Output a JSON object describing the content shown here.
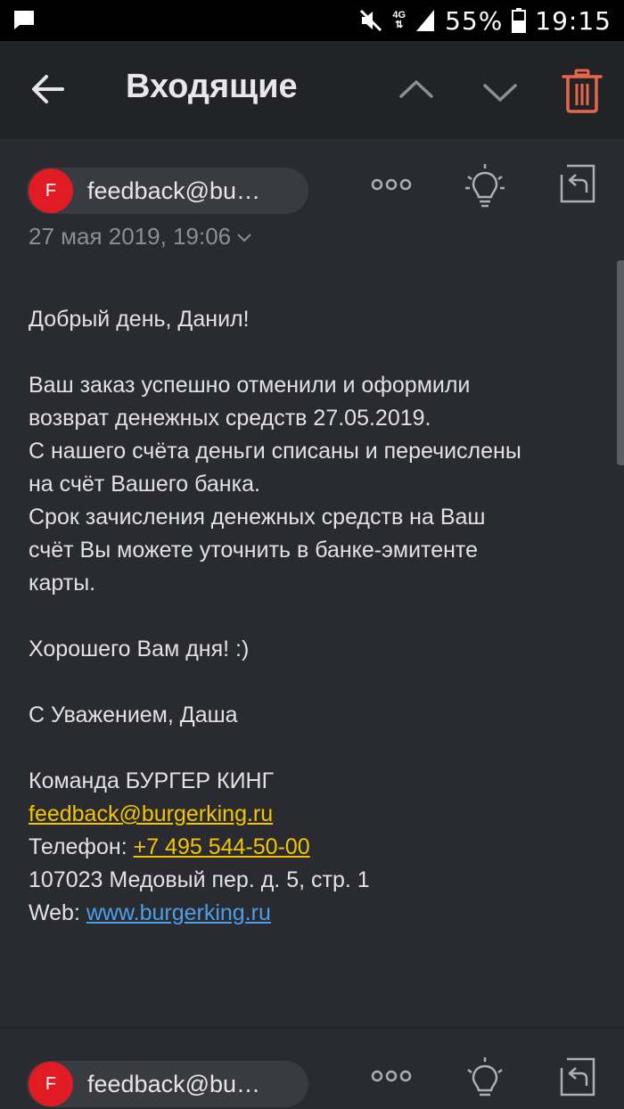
{
  "status_bar": {
    "battery_percent": "55%",
    "time": "19:15",
    "network": "4G"
  },
  "toolbar": {
    "title": "Входящие"
  },
  "message": {
    "sender_email": "feedback@bu…",
    "sender_initial": "F",
    "date": "27 мая 2019, 19:06",
    "body": {
      "greeting": "Добрый день, Данил!",
      "para1": [
        "Ваш заказ успешно отменили и оформили",
        "возврат денежных средств 27.05.2019.",
        "С нашего счёта деньги списаны и перечислены",
        "на счёт Вашего банка.",
        "Срок зачисления денежных средств на Ваш",
        "счёт Вы можете уточнить в банке-эмитенте",
        "карты."
      ],
      "wish": "Хорошего Вам дня! :)",
      "signoff": "С Уважением, Даша",
      "team": "Команда БУРГЕР КИНГ",
      "email_link": "feedback@burgerking.ru",
      "phone_label": "Телефон: ",
      "phone_link": "+7 495 544-50-00",
      "address": "107023 Медовый пер. д. 5, стр. 1",
      "web_label": "Web: ",
      "web_link": "www.burgerking.ru"
    }
  },
  "next_message": {
    "sender_email": "feedback@bu…",
    "sender_initial": "F"
  },
  "colors": {
    "accent_link": "#f5c400",
    "web_link": "#4d9ee8",
    "trash": "#e8664a",
    "avatar": "#e01b24"
  }
}
